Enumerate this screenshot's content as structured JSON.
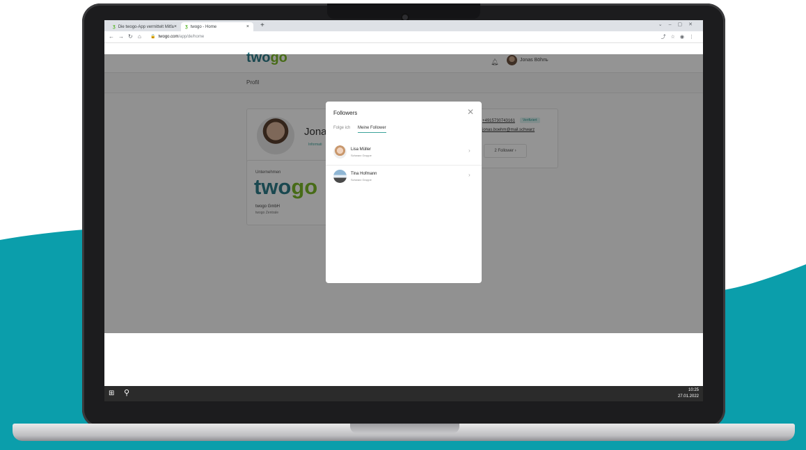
{
  "browser": {
    "tabs": [
      {
        "label": "Die twogo-App vermittelt Mitfa",
        "active": false
      },
      {
        "label": "twogo - Home",
        "active": true
      }
    ],
    "url_host": "twogo.com",
    "url_path": "/app/de/home"
  },
  "header": {
    "logo_prefix": "two",
    "logo_suffix": "go",
    "user_name": "Jonas Böhm"
  },
  "page": {
    "title": "Profil"
  },
  "profile": {
    "name": "Jonas",
    "info_link": "Informati",
    "phone": "+4915730743161",
    "verified_badge": "Verifiziert",
    "email": "jonas.boehm@mail.schwarz",
    "follower_button": "2 Follower ›"
  },
  "company": {
    "label": "Unternehmen",
    "logo_prefix": "two",
    "logo_suffix": "go",
    "name": "twogo GmbH",
    "location": "twogo Zentrale"
  },
  "modal": {
    "title": "Followers",
    "close_icon": "close-icon",
    "tabs": [
      "Folge ich",
      "Meine Follower"
    ],
    "active_tab": "Meine Follower",
    "followers": [
      {
        "name": "Lisa Müller",
        "group": "Schwarz Gruppe"
      },
      {
        "name": "Tina Hofmann",
        "group": "Schwarz Gruppe"
      }
    ]
  },
  "taskbar": {
    "time": "10:25",
    "date": "27.01.2022"
  },
  "colors": {
    "teal_background": "#0b9eab",
    "brand_teal": "#2e7d8a",
    "brand_green": "#7ab929",
    "accent": "#3aa39a"
  }
}
